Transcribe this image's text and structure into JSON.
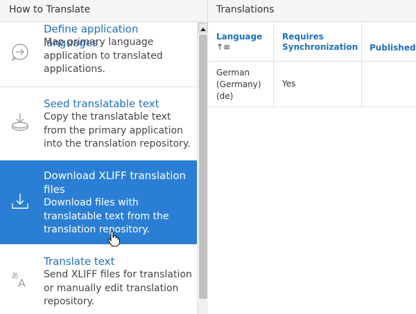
{
  "left": {
    "header": "How to Translate",
    "items": [
      {
        "title": "Define application languages",
        "desc": "Map primary language application to translated applications.",
        "icon": "chat-arrow-icon"
      },
      {
        "title": "Seed translatable text",
        "desc": "Copy the translatable text from the primary application into the translation repository.",
        "icon": "download-tray-icon"
      },
      {
        "title": "Download XLIFF translation files",
        "desc": "Download files with translatable text from the translation repository.",
        "icon": "download-icon"
      },
      {
        "title": "Translate text",
        "desc": "Send XLIFF files for translation or manually edit translation repository.",
        "icon": "translate-icon"
      }
    ]
  },
  "right": {
    "header": "Translations",
    "columns": [
      "Language",
      "Requires Synchronization",
      "Published"
    ],
    "sort_indicator": "↑≡",
    "rows": [
      {
        "language": "German (Germany) (de)",
        "requires_sync": "Yes",
        "published": ""
      }
    ]
  },
  "colors": {
    "accent": "#1f6fbf",
    "selected": "#2a7fd4"
  }
}
